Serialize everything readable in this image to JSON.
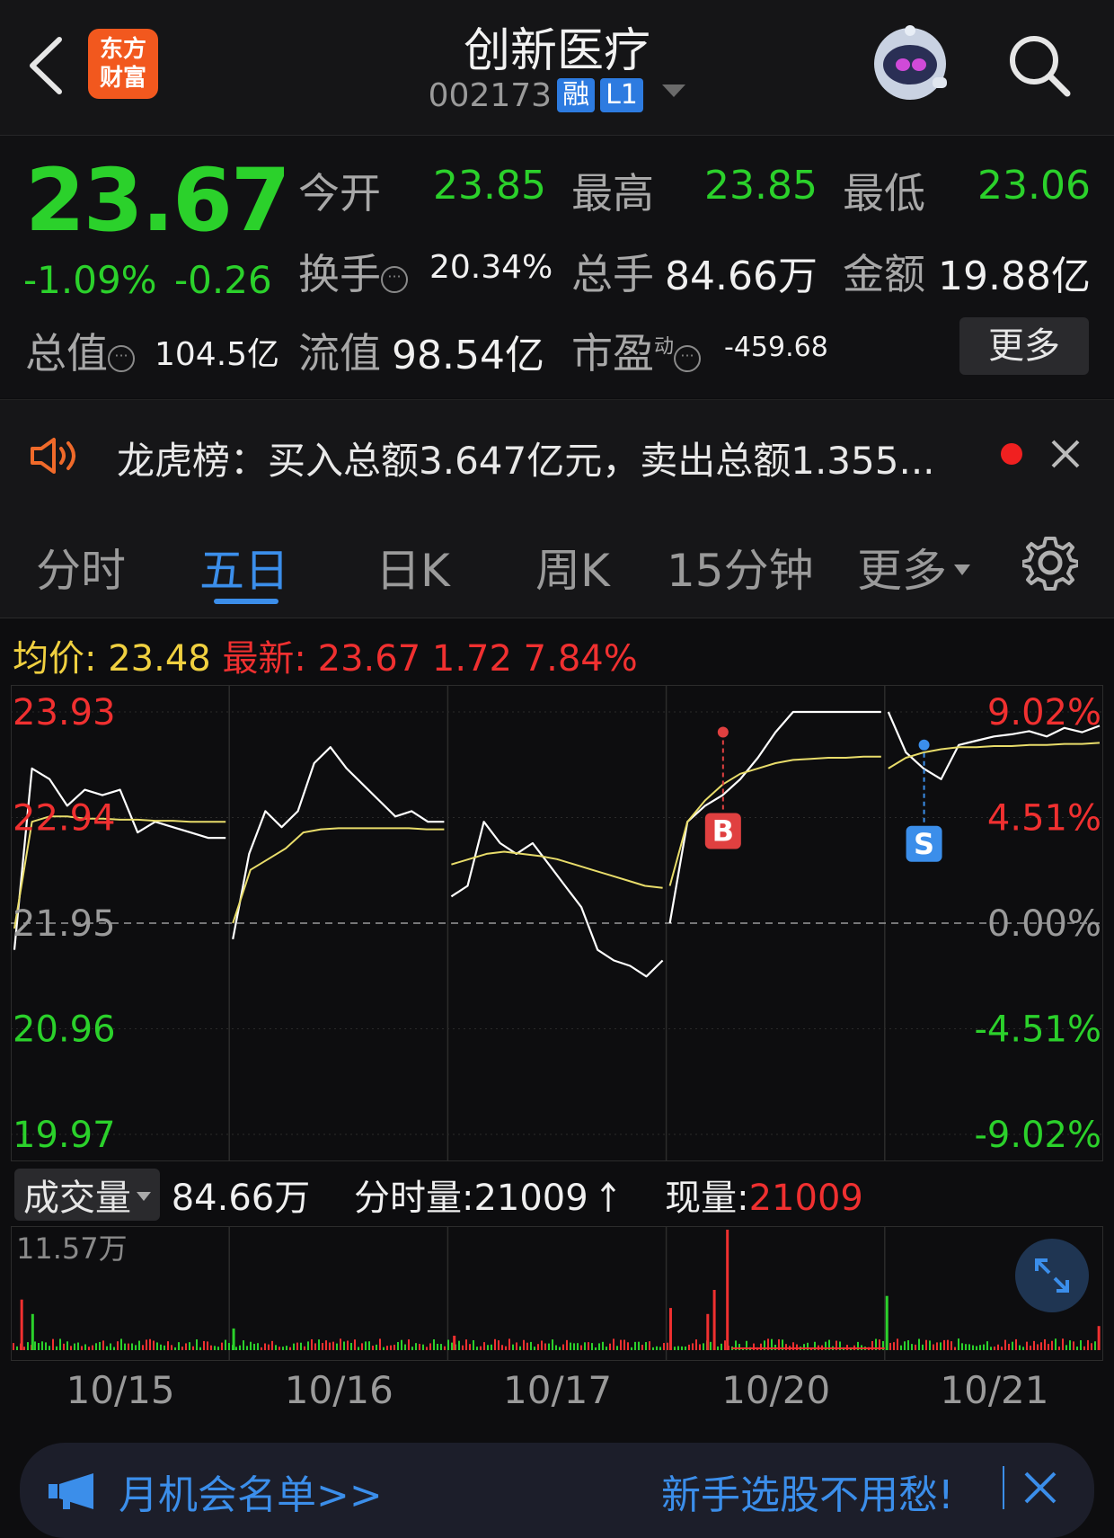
{
  "header": {
    "title": "创新医疗",
    "code": "002173",
    "tag_margin": "融",
    "tag_level": "L1",
    "logo_line1": "东方",
    "logo_line2": "财富"
  },
  "quote": {
    "price": "23.67",
    "change_pct": "-1.09%",
    "change": "-0.26",
    "open_label": "今开",
    "open": "23.85",
    "high_label": "最高",
    "high": "23.85",
    "low_label": "最低",
    "low": "23.06",
    "turnover_label": "换手",
    "turnover": "20.34%",
    "volume_label": "总手",
    "volume": "84.66万",
    "amount_label": "金额",
    "amount": "19.88亿",
    "mktcap_label": "总值",
    "mktcap": "104.5亿",
    "float_label": "流值",
    "float": "98.54亿",
    "pe_label": "市盈",
    "pe_sup": "动",
    "pe": "-459.68",
    "more_label": "更多"
  },
  "notice": {
    "text": "龙虎榜：买入总额3.647亿元，卖出总额1.355..."
  },
  "tabs": {
    "t1": "分时",
    "t2": "五日",
    "t3": "日K",
    "t4": "周K",
    "t5": "15分钟",
    "t6": "更多"
  },
  "info": {
    "avg_label": "均价:",
    "avg": "23.48",
    "latest_label": "最新:",
    "latest": "23.67",
    "chg": "1.72",
    "chg_pct": "7.84%"
  },
  "volume_bar": {
    "selector": "成交量",
    "total": "84.66万",
    "minute_label": "分时量:",
    "minute": "21009",
    "current_label": "现量:",
    "current": "21009",
    "max_label": "11.57万"
  },
  "chart_data": {
    "type": "line",
    "title": "",
    "y_left_ticks": [
      "23.93",
      "22.94",
      "21.95",
      "20.96",
      "19.97"
    ],
    "y_right_ticks": [
      "9.02%",
      "4.51%",
      "0.00%",
      "-4.51%",
      "-9.02%"
    ],
    "ylim": [
      19.97,
      23.93
    ],
    "reference": 21.95,
    "x_labels": [
      "10/15",
      "10/16",
      "10/17",
      "10/20",
      "10/21"
    ],
    "markers": [
      {
        "label": "B",
        "day": "10/20",
        "price": 23.74
      },
      {
        "label": "S",
        "day": "10/21",
        "price": 23.62
      }
    ],
    "series": [
      {
        "name": "",
        "color": "#ffffff",
        "days": [
          [
            21.7,
            23.4,
            23.3,
            23.05,
            23.2,
            23.15,
            23.2,
            22.8,
            22.9,
            22.85,
            22.8,
            22.75,
            22.75
          ],
          [
            21.8,
            22.6,
            23.0,
            22.85,
            23.0,
            23.45,
            23.6,
            23.4,
            23.25,
            23.1,
            22.95,
            23.0,
            22.9,
            22.9
          ],
          [
            22.2,
            22.3,
            22.9,
            22.7,
            22.6,
            22.7,
            22.5,
            22.3,
            22.1,
            21.7,
            21.6,
            21.55,
            21.45,
            21.6
          ],
          [
            21.95,
            22.9,
            23.05,
            23.15,
            23.3,
            23.5,
            23.74,
            23.93,
            23.93,
            23.93,
            23.93,
            23.93,
            23.93
          ],
          [
            23.93,
            23.55,
            23.4,
            23.3,
            23.62,
            23.66,
            23.7,
            23.72,
            23.75,
            23.7,
            23.78,
            23.74,
            23.8
          ]
        ]
      },
      {
        "name": "",
        "color": "#e8dc6a",
        "days": [
          [
            21.9,
            22.9,
            22.95,
            22.95,
            22.93,
            22.93,
            22.92,
            22.92,
            22.91,
            22.91,
            22.9,
            22.9,
            22.9
          ],
          [
            21.95,
            22.45,
            22.55,
            22.65,
            22.8,
            22.83,
            22.84,
            22.84,
            22.84,
            22.84,
            22.84,
            22.83,
            22.83
          ],
          [
            22.5,
            22.55,
            22.6,
            22.62,
            22.6,
            22.58,
            22.55,
            22.5,
            22.45,
            22.4,
            22.35,
            22.3,
            22.28
          ],
          [
            22.3,
            22.9,
            23.1,
            23.25,
            23.35,
            23.4,
            23.45,
            23.48,
            23.49,
            23.5,
            23.5,
            23.51,
            23.51
          ],
          [
            23.4,
            23.5,
            23.55,
            23.58,
            23.6,
            23.6,
            23.61,
            23.61,
            23.62,
            23.62,
            23.63,
            23.63,
            23.64
          ]
        ]
      }
    ],
    "volume_spikes": [
      {
        "day": "10/15",
        "pos": 0.05,
        "rel": 0.42,
        "color": "red"
      },
      {
        "day": "10/15",
        "pos": 0.1,
        "rel": 0.3,
        "color": "green"
      },
      {
        "day": "10/16",
        "pos": 0.02,
        "rel": 0.18,
        "color": "green"
      },
      {
        "day": "10/17",
        "pos": 0.03,
        "rel": 0.12,
        "color": "red"
      },
      {
        "day": "10/20",
        "pos": 0.02,
        "rel": 0.35,
        "color": "red"
      },
      {
        "day": "10/20",
        "pos": 0.19,
        "rel": 0.3,
        "color": "red"
      },
      {
        "day": "10/20",
        "pos": 0.22,
        "rel": 0.5,
        "color": "red"
      },
      {
        "day": "10/20",
        "pos": 0.28,
        "rel": 1.0,
        "color": "red"
      },
      {
        "day": "10/21",
        "pos": 0.01,
        "rel": 0.45,
        "color": "green"
      },
      {
        "day": "10/21",
        "pos": 0.98,
        "rel": 0.2,
        "color": "red"
      }
    ]
  },
  "banner": {
    "left": "月机会名单>>",
    "right": "新手选股不用愁!"
  },
  "colors": {
    "up": "#f03030",
    "down": "#2bd12b",
    "accent": "#3b8eea",
    "avg": "#e8dc6a"
  },
  "icons": {
    "back": "chevron-left-icon",
    "search": "search-icon",
    "speaker": "speaker-icon",
    "close": "close-icon",
    "settings": "gear-icon",
    "expand": "expand-icon",
    "megaphone": "megaphone-icon"
  }
}
